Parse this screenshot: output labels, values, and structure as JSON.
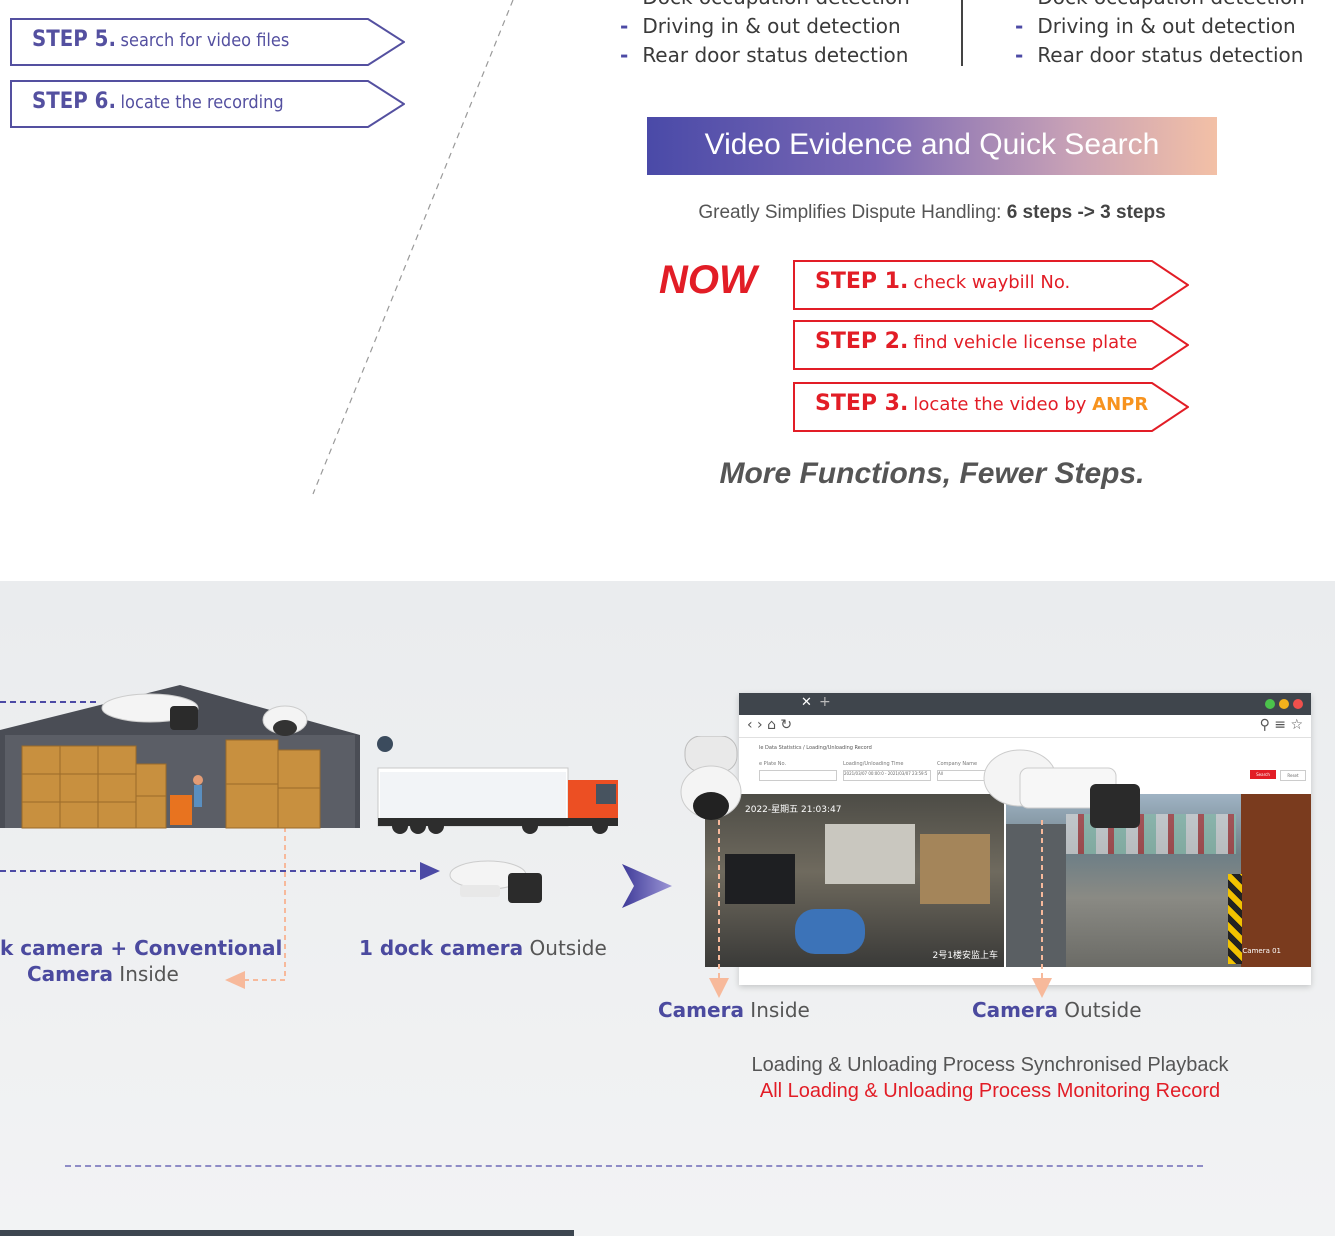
{
  "old_steps": [
    {
      "num": "STEP 5.",
      "label": "search for video files"
    },
    {
      "num": "STEP 6.",
      "label": "locate the recording"
    }
  ],
  "left_features": [
    "Dock occupation detection",
    "Driving in & out detection",
    "Rear door status detection"
  ],
  "right_features": [
    "Dock occupation detection",
    "Driving in & out detection",
    "Rear door status detection"
  ],
  "banner": {
    "title": "Video Evidence and Quick Search"
  },
  "subtitle": {
    "prefix": "Greatly Simplifies Dispute Handling: ",
    "bold": "6 steps -> 3 steps"
  },
  "now_label": "NOW",
  "new_steps": [
    {
      "num": "STEP 1.",
      "label": "check waybill No.",
      "highlight": ""
    },
    {
      "num": "STEP 2.",
      "label": "find vehicle license plate",
      "highlight": ""
    },
    {
      "num": "STEP 3.",
      "label": "locate the video by ",
      "highlight": "ANPR"
    }
  ],
  "tagline": "More Functions, Fewer Steps.",
  "captions": {
    "left_cam_line1_bold": "k camera + Conventional",
    "left_cam_line2_bold": "Camera",
    "left_cam_line2_rest": " Inside",
    "dock_bold": "1 dock camera",
    "dock_rest": " Outside",
    "inside_bold": "Camera",
    "inside_rest": " Inside",
    "outside_bold": "Camera",
    "outside_rest": " Outside"
  },
  "footer": {
    "line1": "Loading & Unloading Process  Synchronised Playback",
    "line2": "All Loading & Unloading Process Monitoring Record"
  },
  "screen": {
    "breadcrumb": "le Data Statistics  /  Loading/Unloading Record",
    "field1": "e Plate No.",
    "field2": "Loading/Unloading Time",
    "field2_value": "2021/03/07 00:00:0 - 2021/03/07 23:59:5",
    "field3": "Company Name",
    "field3_value": "All",
    "search_btn": "Search",
    "reset_btn": "Reset",
    "cam1_overlay_top": "2022-星期五  21:03:47",
    "cam1_overlay_bottom": "2号1楼安监上车",
    "cam2_overlay": "Camera 01"
  },
  "colors": {
    "brand_purple": "#4c4aa5",
    "red": "#e21d26",
    "orange": "#f7931e",
    "peach": "#f7b99b"
  }
}
